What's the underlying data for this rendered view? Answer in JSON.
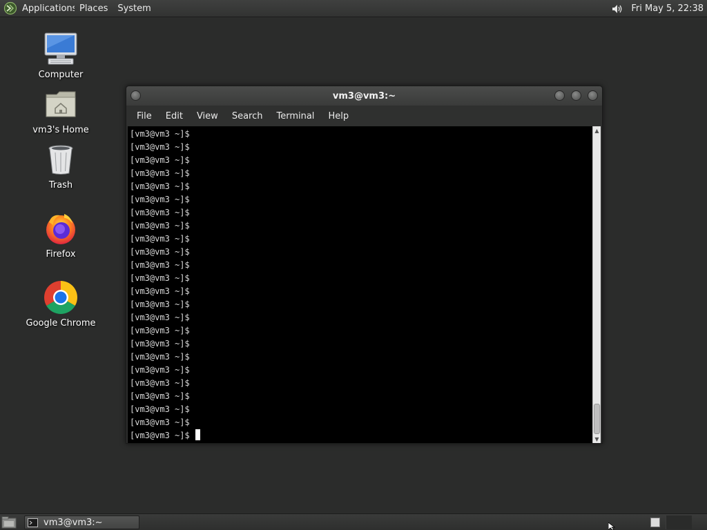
{
  "top_panel": {
    "menus": [
      "Applications",
      "Places",
      "System"
    ],
    "clock": "Fri May  5, 22:38"
  },
  "desktop_icons": [
    {
      "label": "Computer",
      "icon": "computer-icon"
    },
    {
      "label": "vm3's Home",
      "icon": "home-folder-icon"
    },
    {
      "label": "Trash",
      "icon": "trash-icon"
    },
    {
      "label": "Firefox",
      "icon": "firefox-icon"
    },
    {
      "label": "Google Chrome",
      "icon": "chrome-icon"
    }
  ],
  "terminal": {
    "title": "vm3@vm3:~",
    "menu": [
      "File",
      "Edit",
      "View",
      "Search",
      "Terminal",
      "Help"
    ],
    "prompt": "[vm3@vm3 ~]$",
    "lines": [
      "[vm3@vm3 ~]$",
      "[vm3@vm3 ~]$",
      "[vm3@vm3 ~]$",
      "[vm3@vm3 ~]$",
      "[vm3@vm3 ~]$",
      "[vm3@vm3 ~]$",
      "[vm3@vm3 ~]$",
      "[vm3@vm3 ~]$",
      "[vm3@vm3 ~]$",
      "[vm3@vm3 ~]$",
      "[vm3@vm3 ~]$",
      "[vm3@vm3 ~]$",
      "[vm3@vm3 ~]$",
      "[vm3@vm3 ~]$",
      "[vm3@vm3 ~]$",
      "[vm3@vm3 ~]$",
      "[vm3@vm3 ~]$",
      "[vm3@vm3 ~]$",
      "[vm3@vm3 ~]$",
      "[vm3@vm3 ~]$",
      "[vm3@vm3 ~]$",
      "[vm3@vm3 ~]$",
      "[vm3@vm3 ~]$"
    ]
  },
  "taskbar": {
    "task_label": "vm3@vm3:~"
  },
  "colors": {
    "desktop": "#2b2c2b",
    "terminal_bg": "#000000",
    "terminal_fg": "#d9d9d9"
  }
}
